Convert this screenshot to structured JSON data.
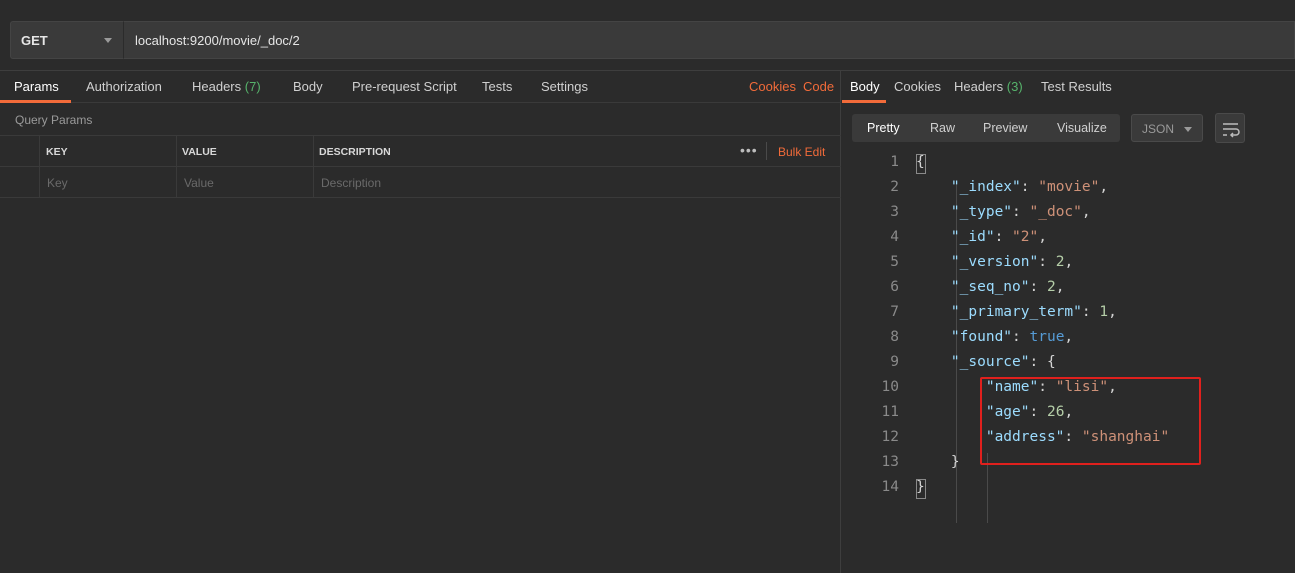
{
  "request": {
    "method": "GET",
    "url": "localhost:9200/movie/_doc/2"
  },
  "request_tabs": {
    "params": "Params",
    "authorization": "Authorization",
    "headers": "Headers",
    "headers_count": "(7)",
    "body": "Body",
    "prerequest": "Pre-request Script",
    "tests": "Tests",
    "settings": "Settings",
    "cookies": "Cookies",
    "code": "Code"
  },
  "query_params": {
    "title": "Query Params",
    "columns": [
      "KEY",
      "VALUE",
      "DESCRIPTION"
    ],
    "more": "•••",
    "bulk_edit": "Bulk Edit",
    "placeholders": {
      "key": "Key",
      "value": "Value",
      "description": "Description"
    }
  },
  "response_tabs": {
    "body": "Body",
    "cookies": "Cookies",
    "headers": "Headers",
    "headers_count": "(3)",
    "test_results": "Test Results"
  },
  "response_toolbar": {
    "pretty": "Pretty",
    "raw": "Raw",
    "preview": "Preview",
    "visualize": "Visualize",
    "format": "JSON",
    "wrap_icon": "wrap-lines-icon"
  },
  "response_body": {
    "line_numbers": [
      "1",
      "2",
      "3",
      "4",
      "5",
      "6",
      "7",
      "8",
      "9",
      "10",
      "11",
      "12",
      "13",
      "14"
    ],
    "lines": [
      {
        "indent": "",
        "key": "",
        "sep": "",
        "value": "{",
        "vtype": "p"
      },
      {
        "indent": "    ",
        "key": "\"_index\"",
        "sep": ": ",
        "value": "\"movie\"",
        "vtype": "s",
        "end": ","
      },
      {
        "indent": "    ",
        "key": "\"_type\"",
        "sep": ": ",
        "value": "\"_doc\"",
        "vtype": "s",
        "end": ","
      },
      {
        "indent": "    ",
        "key": "\"_id\"",
        "sep": ": ",
        "value": "\"2\"",
        "vtype": "s",
        "end": ","
      },
      {
        "indent": "    ",
        "key": "\"_version\"",
        "sep": ": ",
        "value": "2",
        "vtype": "n",
        "end": ","
      },
      {
        "indent": "    ",
        "key": "\"_seq_no\"",
        "sep": ": ",
        "value": "2",
        "vtype": "n",
        "end": ","
      },
      {
        "indent": "    ",
        "key": "\"_primary_term\"",
        "sep": ": ",
        "value": "1",
        "vtype": "n",
        "end": ","
      },
      {
        "indent": "    ",
        "key": "\"found\"",
        "sep": ": ",
        "value": "true",
        "vtype": "b",
        "end": ","
      },
      {
        "indent": "    ",
        "key": "\"_source\"",
        "sep": ": ",
        "value": "{",
        "vtype": "p",
        "end": ""
      },
      {
        "indent": "        ",
        "key": "\"name\"",
        "sep": ": ",
        "value": "\"lisi\"",
        "vtype": "s",
        "end": ","
      },
      {
        "indent": "        ",
        "key": "\"age\"",
        "sep": ": ",
        "value": "26",
        "vtype": "n",
        "end": ","
      },
      {
        "indent": "        ",
        "key": "\"address\"",
        "sep": ": ",
        "value": "\"shanghai\"",
        "vtype": "s",
        "end": ""
      },
      {
        "indent": "    ",
        "key": "",
        "sep": "",
        "value": "}",
        "vtype": "p",
        "end": ""
      },
      {
        "indent": "",
        "key": "",
        "sep": "",
        "value": "}",
        "vtype": "p",
        "end": ""
      }
    ]
  },
  "colors": {
    "accent": "#f26b3a",
    "highlight_box": "#e0201d",
    "count_green": "#56b36b"
  }
}
